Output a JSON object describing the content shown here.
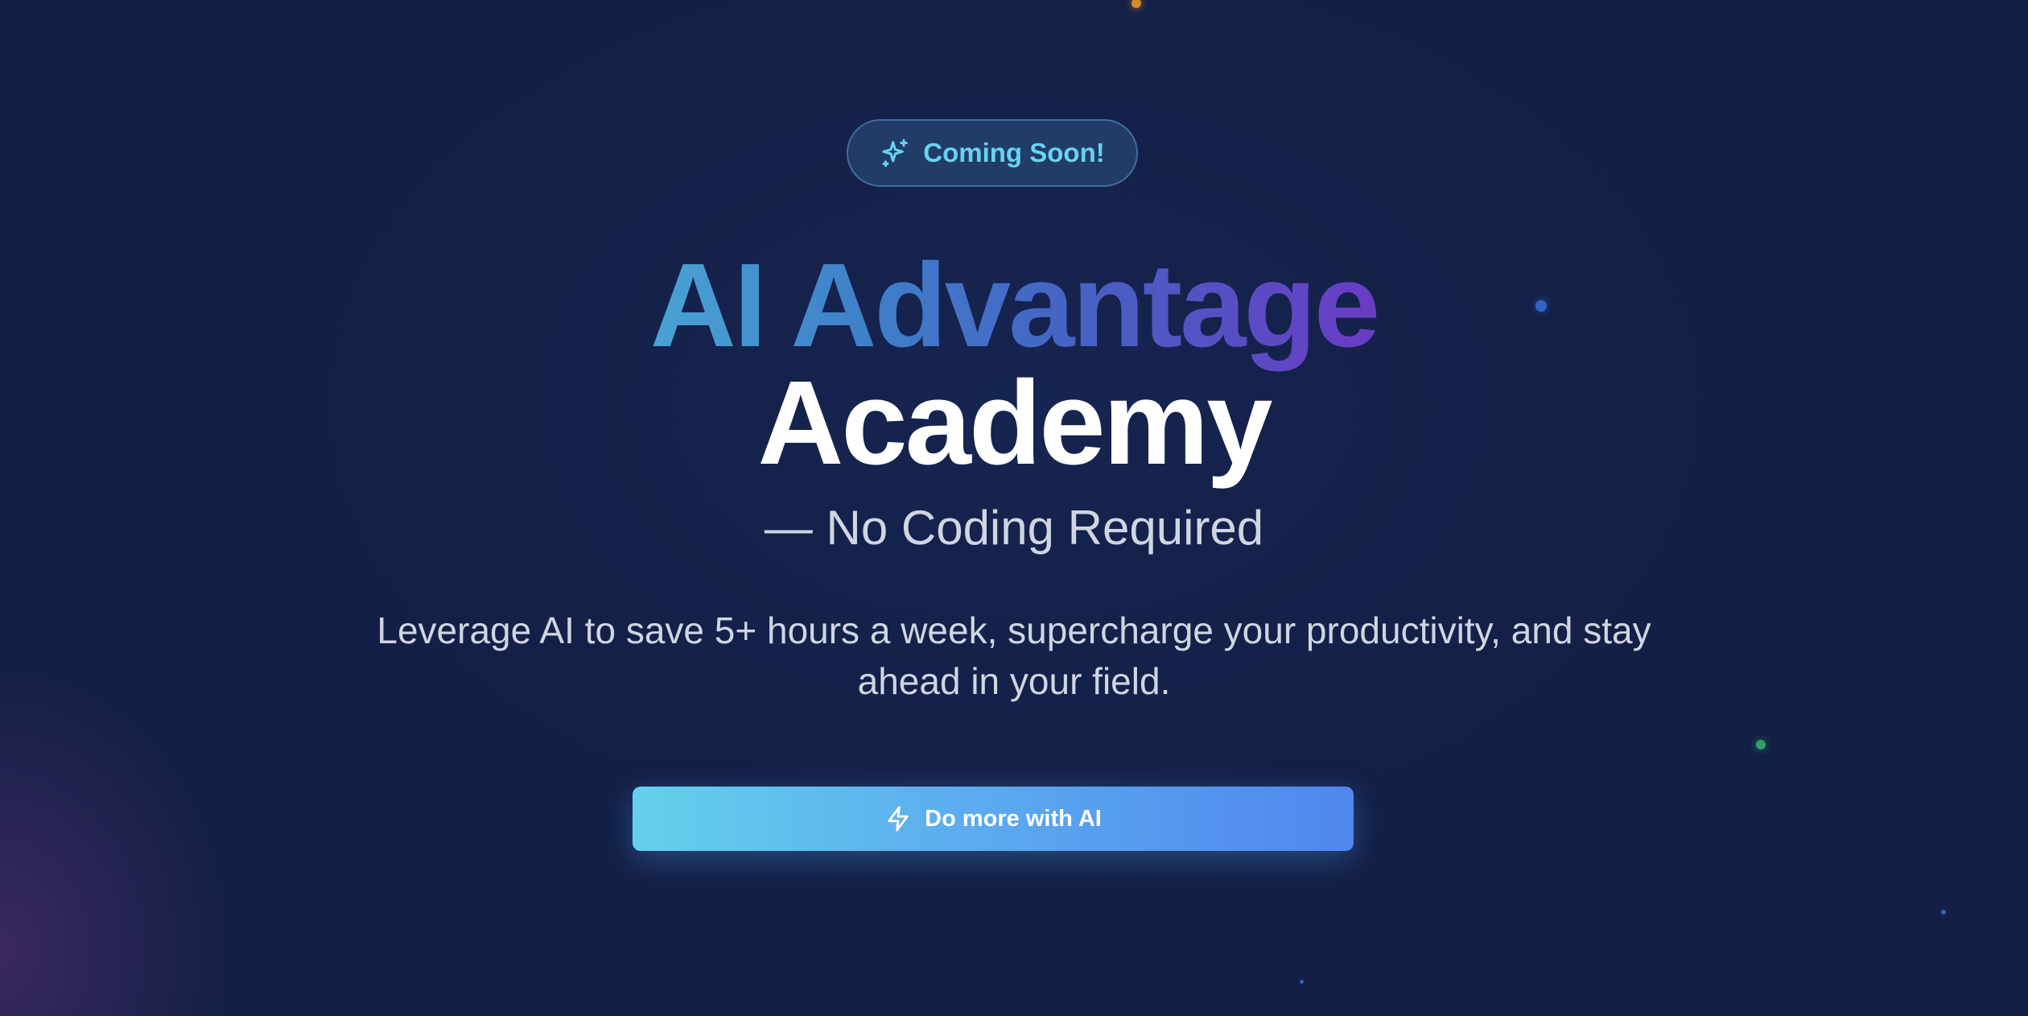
{
  "badge": {
    "icon": "sparkle-icon",
    "label": "Coming Soon!"
  },
  "hero": {
    "title_gradient": "AI Advantage",
    "title_plain": "Academy",
    "subtitle": "— No Coding Required",
    "description": "Leverage AI to save 5+ hours a week, supercharge your productivity, and stay ahead in your field."
  },
  "cta": {
    "icon": "bolt-icon",
    "label": "Do more with AI"
  },
  "colors": {
    "background": "#131f45",
    "accent_cyan": "#66d3f0",
    "gradient_start": "#4aa3d4",
    "gradient_end": "#6a3bc4",
    "button_start": "#64d0ec",
    "button_end": "#4f86ee"
  }
}
